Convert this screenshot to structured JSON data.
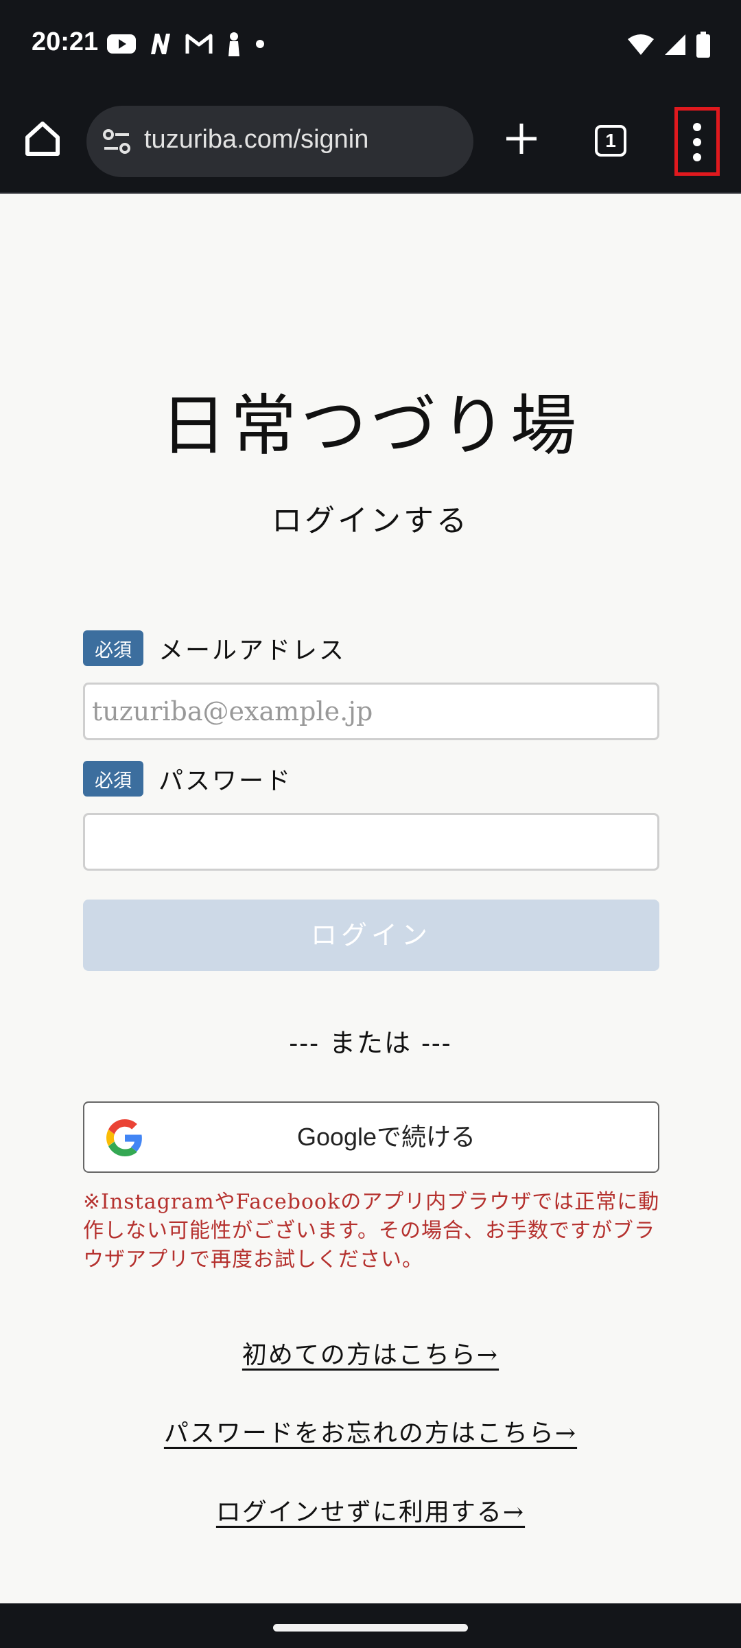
{
  "status_bar": {
    "time": "20:21",
    "notification_icons": [
      "youtube-icon",
      "n-app-icon",
      "gmail-icon",
      "figure-icon",
      "dot-icon"
    ],
    "system_icons": [
      "wifi-icon",
      "signal-icon",
      "battery-icon"
    ]
  },
  "browser": {
    "url": "tuzuriba.com/signin",
    "tab_count": "1"
  },
  "page": {
    "site_title": "日常つづり場",
    "subtitle": "ログインする",
    "email": {
      "badge": "必須",
      "label": "メールアドレス",
      "placeholder": "tuzuriba@example.jp",
      "value": ""
    },
    "password": {
      "badge": "必須",
      "label": "パスワード",
      "value": ""
    },
    "login_button": "ログイン",
    "or_text": "--- または ---",
    "google_button": "Googleで続ける",
    "warning": "※InstagramやFacebookのアプリ内ブラウザでは正常に動作しない可能性がございます。その場合、お手数ですがブラウザアプリで再度お試しください。",
    "links": {
      "first_time": "初めての方はこちら→",
      "forgot_password": "パスワードをお忘れの方はこちら→",
      "guest": "ログインせずに利用する→"
    }
  },
  "colors": {
    "badge": "#3c6e9e",
    "login_disabled": "#cdd9e7",
    "warning": "#b5312e",
    "menu_highlight": "#e0191e"
  }
}
